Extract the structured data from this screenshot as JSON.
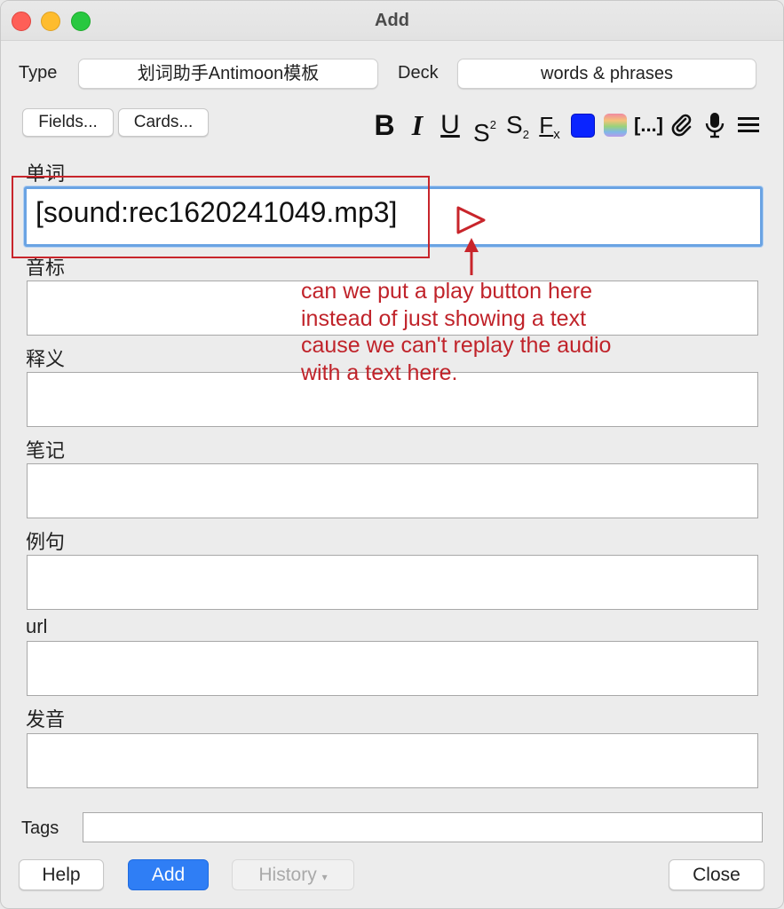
{
  "window": {
    "title": "Add"
  },
  "header": {
    "type_label": "Type",
    "type_value": "划词助手Antimoon模板",
    "deck_label": "Deck",
    "deck_value": "words & phrases"
  },
  "toolbar": {
    "fields_button": "Fields...",
    "cards_button": "Cards...",
    "bold": "B",
    "italic": "I",
    "underline": "U",
    "superscript_base": "S",
    "superscript_mark": "2",
    "subscript_base": "S",
    "subscript_mark": "2",
    "clear_format_base": "F",
    "clear_format_mark": "x",
    "text_color": "#0a24ff",
    "cloze": "[...]"
  },
  "fields": [
    {
      "label": "单词",
      "value": "[sound:rec1620241049.mp3]"
    },
    {
      "label": "音标",
      "value": ""
    },
    {
      "label": "释义",
      "value": ""
    },
    {
      "label": "笔记",
      "value": ""
    },
    {
      "label": "例句",
      "value": ""
    },
    {
      "label": "url",
      "value": ""
    },
    {
      "label": "发音",
      "value": ""
    }
  ],
  "annotation": {
    "lines": [
      "can we put a play button here",
      "instead of just showing a text",
      "cause we can't replay the audio",
      "with a text here."
    ],
    "color": "#c0232a"
  },
  "tags": {
    "label": "Tags",
    "value": ""
  },
  "buttons": {
    "help": "Help",
    "add": "Add",
    "history": "History",
    "history_arrow": "▾",
    "close": "Close"
  }
}
